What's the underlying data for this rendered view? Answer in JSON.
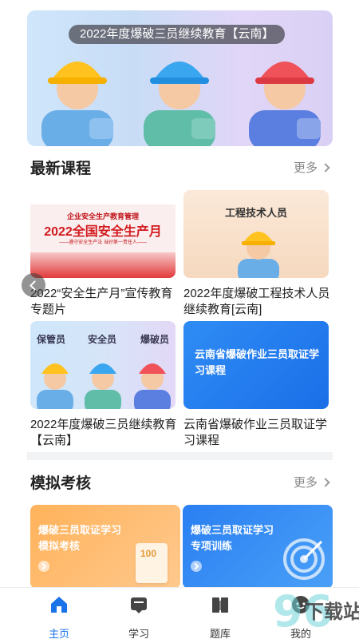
{
  "banner": {
    "title": "2022年度爆破三员继续教育【云南】"
  },
  "latest": {
    "title": "最新课程",
    "more": "更多",
    "cards": [
      {
        "title": "2022“安全生产月”宣传教育专题片",
        "image_text": {
          "line1": "企业安全生产教育管理",
          "line2": "2022全国安全生产月",
          "line3": "——遵守安全生产法 当好第一责任人——"
        }
      },
      {
        "title": "2022年度爆破工程技术人员继续教育[云南]",
        "image_text": "工程技术人员"
      },
      {
        "title": " 2022年度爆破三员继续教育【云南】",
        "image_labels": [
          "保管员",
          "安全员",
          "爆破员"
        ]
      },
      {
        "title": "云南省爆破作业三员取证学习课程",
        "image_text": "云南省爆破作业三员取证学习课程"
      }
    ]
  },
  "exam": {
    "title": "模拟考核",
    "more": "更多",
    "cards": [
      {
        "line1": "爆破三员取证学习",
        "line2": "模拟考核",
        "badge": "100"
      },
      {
        "line1": "爆破三员取证学习",
        "line2": "专项训练"
      }
    ]
  },
  "tabs": [
    {
      "label": "主页",
      "icon": "home-icon",
      "active": true
    },
    {
      "label": "学习",
      "icon": "study-icon",
      "active": false
    },
    {
      "label": "题库",
      "icon": "question-bank-icon",
      "active": false
    },
    {
      "label": "我的",
      "icon": "profile-icon",
      "active": false
    }
  ],
  "watermark": "下载站",
  "colors": {
    "accent": "#1a73e8",
    "orange": "#ffb25a",
    "blue": "#2a7ff2"
  }
}
